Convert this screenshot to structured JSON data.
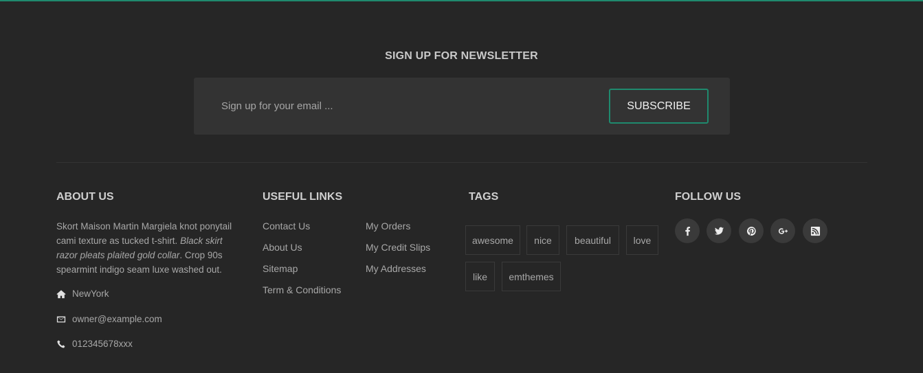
{
  "newsletter": {
    "title": "SIGN UP FOR NEWSLETTER",
    "placeholder": "Sign up for your email ...",
    "button_label": "SUBSCRIBE",
    "accent_color": "#1f8a6e"
  },
  "about": {
    "title": "ABOUT US",
    "text_part1": "Skort Maison Martin Margiela knot ponytail cami texture as tucked t-shirt. ",
    "text_italic": "Black skirt razor pleats plaited gold collar",
    "text_part2": ". Crop 90s spearmint indigo seam luxe washed out.",
    "location": "NewYork",
    "email": "owner@example.com",
    "phone": "012345678xxx"
  },
  "useful_links": {
    "title": "USEFUL LINKS",
    "col1": [
      "Contact Us",
      "About Us",
      "Sitemap",
      "Term & Conditions"
    ],
    "col2": [
      "My Orders",
      "My Credit Slips",
      "My Addresses"
    ]
  },
  "tags": {
    "title": "TAGS",
    "items": [
      "awesome",
      "nice",
      "beautiful",
      "love",
      "like",
      "emthemes"
    ]
  },
  "follow": {
    "title": "FOLLOW US",
    "icons": [
      "facebook-icon",
      "twitter-icon",
      "pinterest-icon",
      "google-plus-icon",
      "rss-icon"
    ]
  }
}
